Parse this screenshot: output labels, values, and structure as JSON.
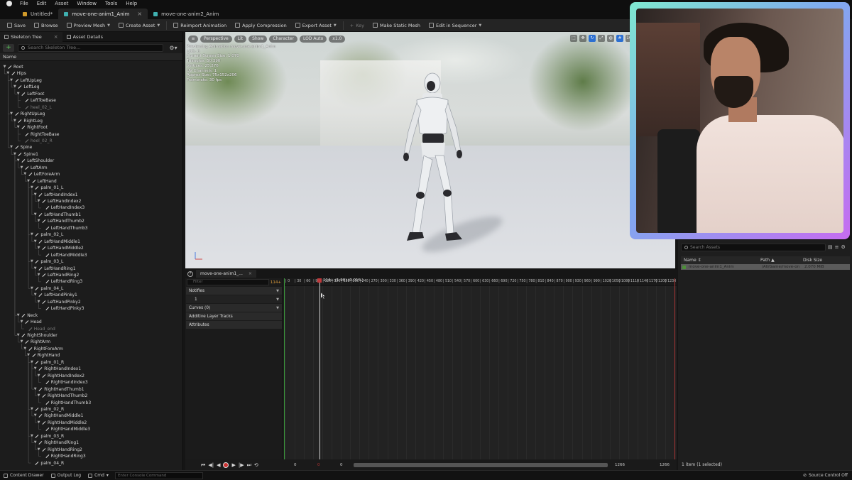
{
  "menu": [
    "File",
    "Edit",
    "Asset",
    "Window",
    "Tools",
    "Help"
  ],
  "tabs": [
    {
      "label": "Untitled",
      "suffix": "*",
      "active": false
    },
    {
      "label": "move-one-anim1_Anim",
      "active": true
    },
    {
      "label": "move-one-anim2_Anim",
      "active": false
    }
  ],
  "toolbar": {
    "save": "Save",
    "browse": "Browse",
    "preview_mesh": "Preview Mesh",
    "create_asset": "Create Asset",
    "reimport": "Reimport Animation",
    "apply_compression": "Apply Compression",
    "export_asset": "Export Asset",
    "key": "Key",
    "make_static_mesh": "Make Static Mesh",
    "edit_in_sequencer": "Edit in Sequencer"
  },
  "left_panel": {
    "tab_skeleton": "Skeleton Tree",
    "tab_asset_details": "Asset Details",
    "search_placeholder": "Search Skeleton Tree...",
    "column_name": "Name"
  },
  "skeleton_tree": [
    {
      "name": "Root",
      "depth": 0
    },
    {
      "name": "Hips",
      "depth": 1
    },
    {
      "name": "LeftUpLeg",
      "depth": 2
    },
    {
      "name": "LeftLeg",
      "depth": 3
    },
    {
      "name": "LeftFoot",
      "depth": 4
    },
    {
      "name": "LeftToeBase",
      "depth": 5
    },
    {
      "name": "heel_02_L",
      "depth": 5,
      "dim": true
    },
    {
      "name": "RightUpLeg",
      "depth": 2
    },
    {
      "name": "RightLeg",
      "depth": 3
    },
    {
      "name": "RightFoot",
      "depth": 4
    },
    {
      "name": "RightToeBase",
      "depth": 5
    },
    {
      "name": "heel_02_R",
      "depth": 5,
      "dim": true
    },
    {
      "name": "Spine",
      "depth": 2
    },
    {
      "name": "Spine1",
      "depth": 3
    },
    {
      "name": "LeftShoulder",
      "depth": 4
    },
    {
      "name": "LeftArm",
      "depth": 5
    },
    {
      "name": "LeftForeArm",
      "depth": 6
    },
    {
      "name": "LeftHand",
      "depth": 7
    },
    {
      "name": "palm_01_L",
      "depth": 8
    },
    {
      "name": "LeftHandIndex1",
      "depth": 9
    },
    {
      "name": "LeftHandIndex2",
      "depth": 10
    },
    {
      "name": "LeftHandIndex3",
      "depth": 11
    },
    {
      "name": "LeftHandThumb1",
      "depth": 9
    },
    {
      "name": "LeftHandThumb2",
      "depth": 10
    },
    {
      "name": "LeftHandThumb3",
      "depth": 11
    },
    {
      "name": "palm_02_L",
      "depth": 8
    },
    {
      "name": "LeftHandMiddle1",
      "depth": 9
    },
    {
      "name": "LeftHandMiddle2",
      "depth": 10
    },
    {
      "name": "LeftHandMiddle3",
      "depth": 11
    },
    {
      "name": "palm_03_L",
      "depth": 8
    },
    {
      "name": "LeftHandRing1",
      "depth": 9
    },
    {
      "name": "LeftHandRing2",
      "depth": 10
    },
    {
      "name": "LeftHandRing3",
      "depth": 11
    },
    {
      "name": "palm_04_L",
      "depth": 8
    },
    {
      "name": "LeftHandPinky1",
      "depth": 9
    },
    {
      "name": "LeftHandPinky2",
      "depth": 10
    },
    {
      "name": "LeftHandPinky3",
      "depth": 11
    },
    {
      "name": "Neck",
      "depth": 4
    },
    {
      "name": "Head",
      "depth": 5
    },
    {
      "name": "Head_end",
      "depth": 6,
      "dim": true
    },
    {
      "name": "RightShoulder",
      "depth": 4
    },
    {
      "name": "RightArm",
      "depth": 5
    },
    {
      "name": "RightForeArm",
      "depth": 6
    },
    {
      "name": "RightHand",
      "depth": 7
    },
    {
      "name": "palm_01_R",
      "depth": 8
    },
    {
      "name": "RightHandIndex1",
      "depth": 9
    },
    {
      "name": "RightHandIndex2",
      "depth": 10
    },
    {
      "name": "RightHandIndex3",
      "depth": 11
    },
    {
      "name": "RightHandThumb1",
      "depth": 9
    },
    {
      "name": "RightHandThumb2",
      "depth": 10
    },
    {
      "name": "RightHandThumb3",
      "depth": 11
    },
    {
      "name": "palm_02_R",
      "depth": 8
    },
    {
      "name": "RightHandMiddle1",
      "depth": 9
    },
    {
      "name": "RightHandMiddle2",
      "depth": 10
    },
    {
      "name": "RightHandMiddle3",
      "depth": 11
    },
    {
      "name": "palm_03_R",
      "depth": 8
    },
    {
      "name": "RightHandRing1",
      "depth": 9
    },
    {
      "name": "RightHandRing2",
      "depth": 10
    },
    {
      "name": "RightHandRing3",
      "depth": 11
    },
    {
      "name": "palm_04_R",
      "depth": 8
    }
  ],
  "viewport": {
    "chips": [
      "Perspective",
      "Lit",
      "Show",
      "Character",
      "LOD Auto",
      "x1.0"
    ],
    "info_lines": [
      "Previewing Animation move-one-anim1_Anim",
      "LOD: 0",
      "Current Screen Size: 1.070",
      "Triangles: 50,390",
      "Vertices: 25,276",
      "UV Channels: 1",
      "Approx Size: 75x152x206",
      "Framerate: 30 fps"
    ],
    "right_icons": [
      "10"
    ]
  },
  "sequencer": {
    "tab": "move-one-anim1_...",
    "filter_placeholder": "Filter",
    "current_frame": "114+",
    "playhead_label": "114+ (1.90) (0.01%)",
    "tracks": [
      {
        "label": "Notifies",
        "dropdown": true
      },
      {
        "label": "1",
        "dropdown": true,
        "sub": true
      },
      {
        "label": "Curves",
        "count": "(0)",
        "dropdown": true
      },
      {
        "label": "Additive Layer Tracks"
      },
      {
        "label": "Attributes"
      }
    ],
    "ruler": [
      "0",
      "30",
      "60",
      "90",
      "120",
      "150",
      "180",
      "210",
      "240",
      "270",
      "300",
      "330",
      "360",
      "390",
      "420",
      "450",
      "480",
      "510",
      "540",
      "570",
      "600",
      "630",
      "660",
      "690",
      "720",
      "750",
      "780",
      "810",
      "840",
      "870",
      "900",
      "930",
      "960",
      "990",
      "1020",
      "1050",
      "1080",
      "1110",
      "1140",
      "1170",
      "1200",
      "1230"
    ],
    "transport": {
      "start_in": "0",
      "start_out": "0",
      "end_in": "1266",
      "end_out": "1266",
      "mid": "0"
    }
  },
  "content_browser": {
    "search_placeholder": "Search Assets",
    "columns": [
      "Name",
      "Path",
      "Disk Size"
    ],
    "rows": [
      {
        "name": "move-one-anim1_Anim",
        "path": "/All/Game/move-on",
        "size": "2.070 MiB"
      }
    ],
    "status": "1 item (1 selected)"
  },
  "statusbar": {
    "content_drawer": "Content Drawer",
    "output_log": "Output Log",
    "cmd": "Cmd",
    "console_placeholder": "Enter Console Command",
    "source_control": "Source Control Off"
  },
  "colors": {
    "playhead": "#c0393b",
    "webcam_border_start": "#7fe8d0",
    "webcam_border_end": "#c66cf0"
  }
}
